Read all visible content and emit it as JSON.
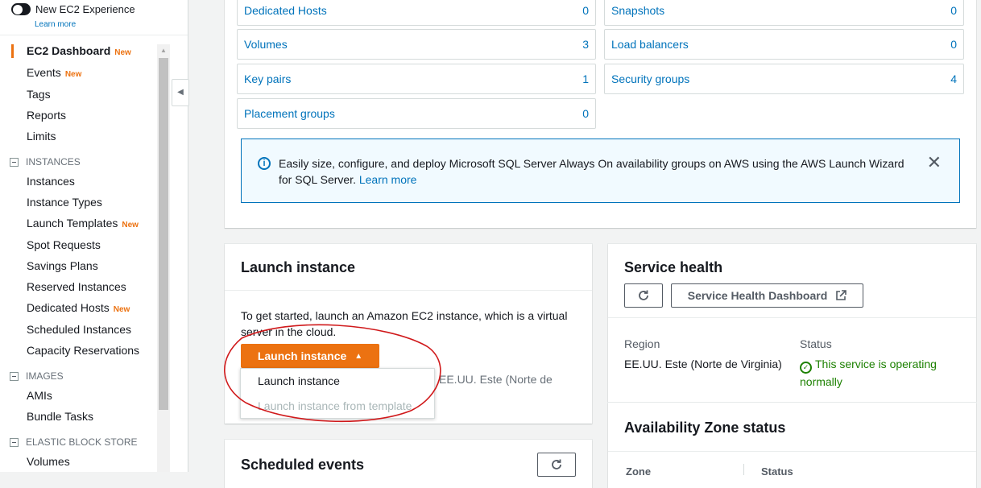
{
  "sidebar": {
    "toggle_label": "New EC2 Experience",
    "learn_more": "Learn more",
    "dashboard": "EC2 Dashboard",
    "new_badge": "New",
    "items": {
      "events": "Events",
      "tags": "Tags",
      "reports": "Reports",
      "limits": "Limits",
      "instances": "Instances",
      "instance_types": "Instance Types",
      "launch_templates": "Launch Templates",
      "spot_requests": "Spot Requests",
      "savings_plans": "Savings Plans",
      "reserved_instances": "Reserved Instances",
      "dedicated_hosts": "Dedicated Hosts",
      "scheduled_instances": "Scheduled Instances",
      "capacity_reservations": "Capacity Reservations",
      "amis": "AMIs",
      "bundle_tasks": "Bundle Tasks",
      "volumes": "Volumes"
    },
    "sections": {
      "instances": "INSTANCES",
      "images": "IMAGES",
      "ebs": "ELASTIC BLOCK STORE"
    }
  },
  "resources": {
    "dedicated_hosts": {
      "label": "Dedicated Hosts",
      "count": "0"
    },
    "volumes": {
      "label": "Volumes",
      "count": "3"
    },
    "key_pairs": {
      "label": "Key pairs",
      "count": "1"
    },
    "placement_groups": {
      "label": "Placement groups",
      "count": "0"
    },
    "snapshots": {
      "label": "Snapshots",
      "count": "0"
    },
    "load_balancers": {
      "label": "Load balancers",
      "count": "0"
    },
    "security_groups": {
      "label": "Security groups",
      "count": "4"
    }
  },
  "alert": {
    "text": "Easily size, configure, and deploy Microsoft SQL Server Always On availability groups on AWS using the AWS Launch Wizard for SQL Server.",
    "link": "Learn more"
  },
  "launch": {
    "title": "Launch instance",
    "description": "To get started, launch an Amazon EC2 instance, which is a virtual server in the cloud.",
    "button": "Launch instance",
    "dropdown_items": [
      "Launch instance",
      "Launch instance from template"
    ],
    "behind_text": "EE.UU. Este (Norte de"
  },
  "scheduled": {
    "title": "Scheduled events"
  },
  "health": {
    "title": "Service health",
    "dashboard_button": "Service Health Dashboard",
    "region_label": "Region",
    "region_value": "EE.UU. Este (Norte de Virginia)",
    "status_label": "Status",
    "status_value": "This service is operating normally"
  },
  "az": {
    "title": "Availability Zone status",
    "col_zone": "Zone",
    "col_status": "Status"
  },
  "colors": {
    "accent": "#ec7211",
    "link": "#0073bb",
    "ok": "#1d8102",
    "annotation": "#d0191b"
  }
}
